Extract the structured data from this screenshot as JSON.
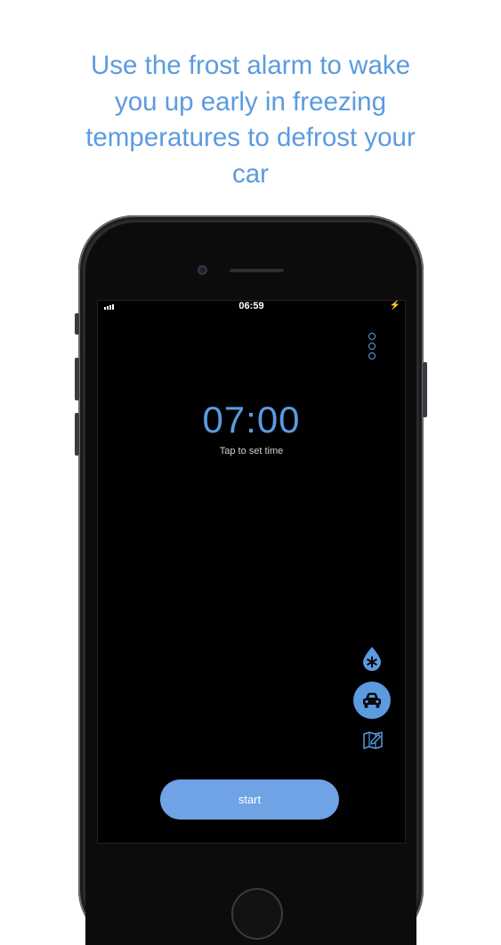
{
  "headline": {
    "lines": [
      "Use the frost alarm to wake",
      "you up early in freezing",
      "temperatures to defrost your",
      "car"
    ]
  },
  "status_bar": {
    "time": "06:59"
  },
  "alarm": {
    "time": "07:00",
    "hint": "Tap to set time"
  },
  "actions": {
    "start_label": "start"
  },
  "icons": {
    "menu": "more-vertical-icon",
    "frost": "frost-drop-icon",
    "car": "car-icon",
    "map": "map-edit-icon"
  },
  "colors": {
    "accent": "#5b9be0",
    "start_button": "#6fa3e6",
    "screen_bg": "#000000"
  }
}
